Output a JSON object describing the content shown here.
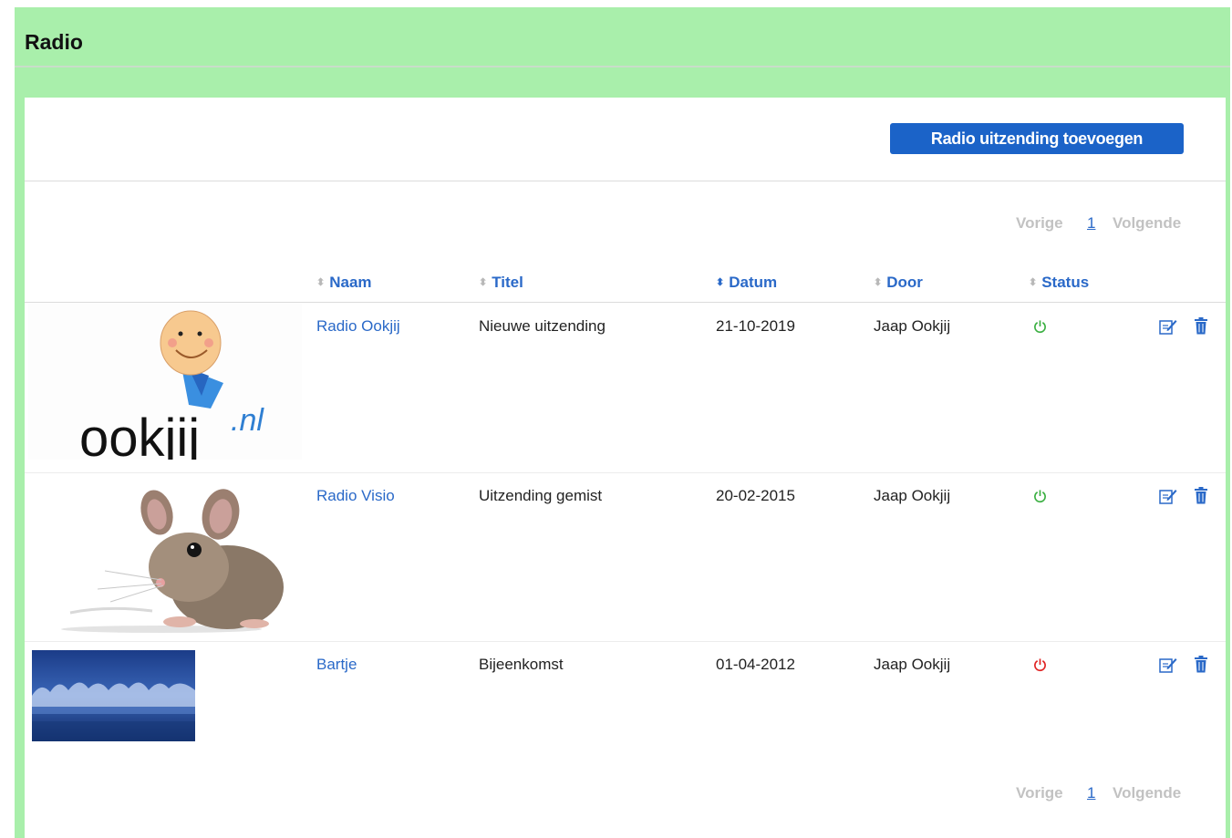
{
  "page": {
    "title": "Radio"
  },
  "toolbar": {
    "add_label": "Radio uitzending toevoegen"
  },
  "pager": {
    "prev": "Vorige",
    "page": "1",
    "next": "Volgende"
  },
  "table": {
    "columns": [
      "Naam",
      "Titel",
      "Datum",
      "Door",
      "Status"
    ],
    "sorted_column": "Datum",
    "rows": [
      {
        "thumb": "ookjij-logo",
        "thumb_text": "ookjij.nl",
        "naam": "Radio Ookjij",
        "titel": "Nieuwe uitzending",
        "datum": "21-10-2019",
        "door": "Jaap Ookjij",
        "status": "active"
      },
      {
        "thumb": "mouse-photo",
        "naam": "Radio Visio",
        "titel": "Uitzending gemist",
        "datum": "20-02-2015",
        "door": "Jaap Ookjij",
        "status": "active"
      },
      {
        "thumb": "blue-fabric-photo",
        "naam": "Bartje",
        "titel": "Bijeenkomst",
        "datum": "01-04-2012",
        "door": "Jaap Ookjij",
        "status": "inactive"
      }
    ]
  },
  "icons": {
    "status_active": "power-icon",
    "status_inactive": "power-icon",
    "edit": "edit-icon",
    "delete": "trash-icon"
  },
  "colors": {
    "header_bg": "#a9efab",
    "accent": "#1b63c8",
    "link": "#2a69c8",
    "status_active": "#3cb043",
    "status_inactive": "#e02424",
    "pager_disabled": "#c2c2c2"
  }
}
